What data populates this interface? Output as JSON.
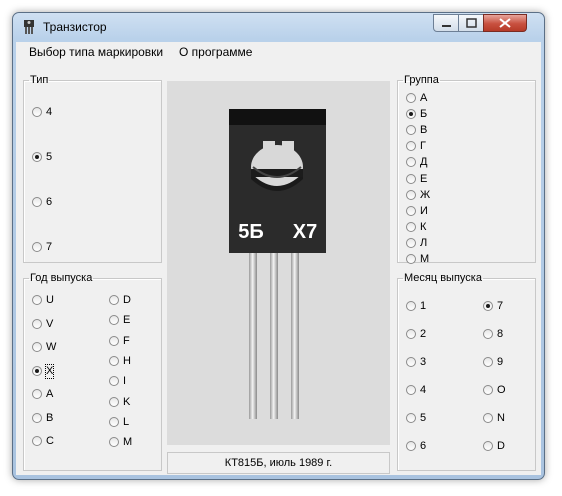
{
  "window": {
    "title": "Транзистор",
    "icon": "transistor-icon"
  },
  "menu": [
    "Выбор типа маркировки",
    "О программе"
  ],
  "type_group": {
    "legend": "Тип",
    "options": [
      "4",
      "5",
      "6",
      "7"
    ],
    "selected": "5"
  },
  "year_group": {
    "legend": "Год выпуска",
    "col1": [
      "U",
      "V",
      "W",
      "X",
      "A",
      "B",
      "C"
    ],
    "col2": [
      "D",
      "E",
      "F",
      "H",
      "I",
      "K",
      "L",
      "M"
    ],
    "selected": "X"
  },
  "group_group": {
    "legend": "Группа",
    "options": [
      "А",
      "Б",
      "В",
      "Г",
      "Д",
      "Е",
      "Ж",
      "И",
      "К",
      "Л",
      "М"
    ],
    "selected": "Б"
  },
  "month_group": {
    "legend": "Месяц выпуска",
    "col1": [
      "1",
      "2",
      "3",
      "4",
      "5",
      "6"
    ],
    "col2": [
      "7",
      "8",
      "9",
      "O",
      "N",
      "D"
    ],
    "selected": "7"
  },
  "transistor_marking": {
    "left": "5Б",
    "right": "X7"
  },
  "status_text": "КТ815Б, июль 1989 г.",
  "colors": {
    "picture_bg": "#dcdcdc",
    "body": "#2b2b2b",
    "tab": "#111111"
  }
}
